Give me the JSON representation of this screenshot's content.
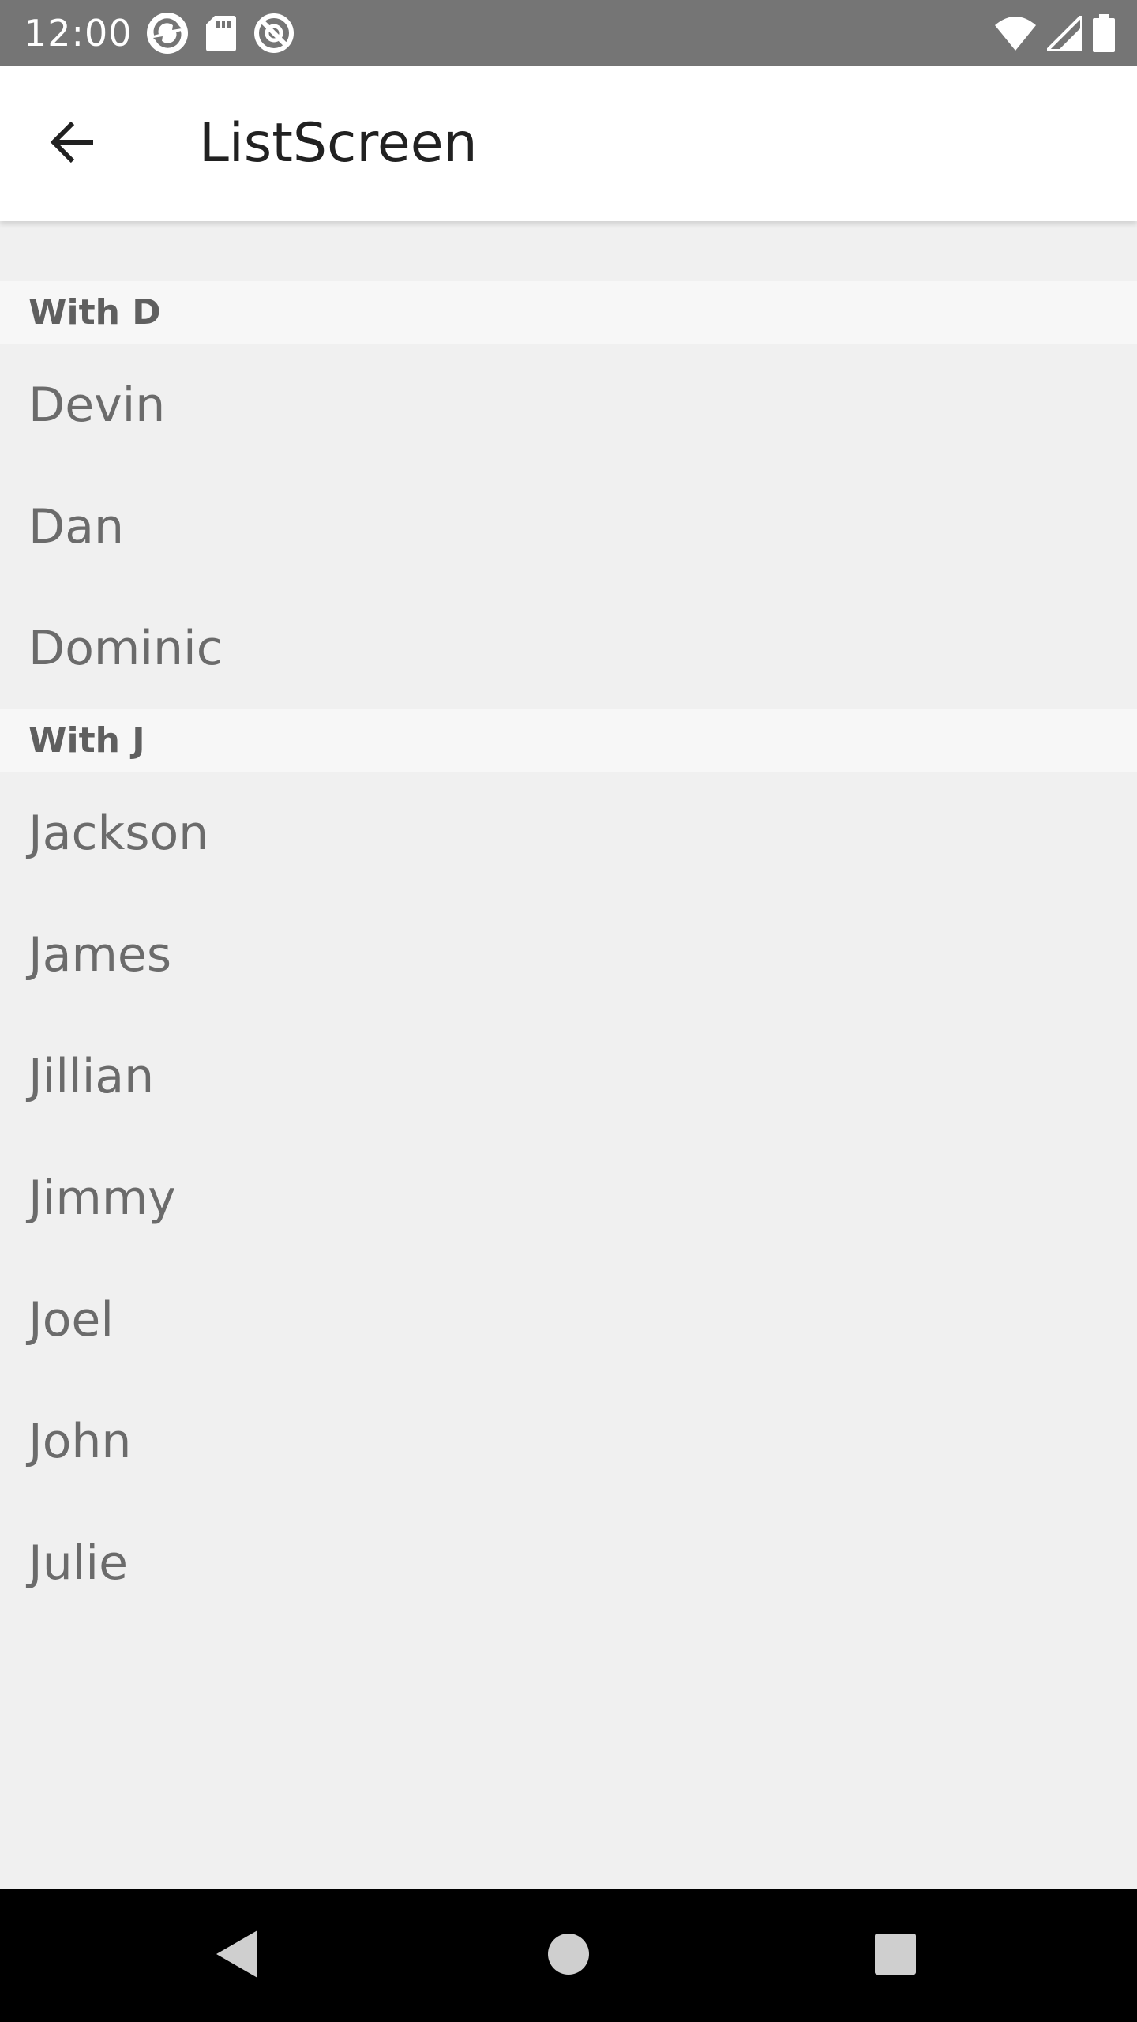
{
  "status_bar": {
    "time": "12:00",
    "left_icons": [
      "sync-icon",
      "sd-card-icon",
      "no-disturb-icon"
    ],
    "right_icons": [
      "wifi-icon",
      "cellular-signal-icon",
      "battery-icon"
    ]
  },
  "app_bar": {
    "title": "ListScreen",
    "back_icon": "arrow-back-icon"
  },
  "sections": [
    {
      "header": "With D",
      "items": [
        "Devin",
        "Dan",
        "Dominic"
      ]
    },
    {
      "header": "With J",
      "items": [
        "Jackson",
        "James",
        "Jillian",
        "Jimmy",
        "Joel",
        "John",
        "Julie"
      ]
    }
  ],
  "nav_bar": {
    "buttons": [
      "nav-back-icon",
      "nav-home-icon",
      "nav-recents-icon"
    ]
  },
  "colors": {
    "status_bar_bg": "#757575",
    "app_bar_bg": "#ffffff",
    "content_bg": "#f0f0f0",
    "section_header_bg": "#f7f7f7",
    "item_text": "#6b6b6b",
    "header_text": "#5f5f5f",
    "nav_bar_bg": "#000000"
  }
}
